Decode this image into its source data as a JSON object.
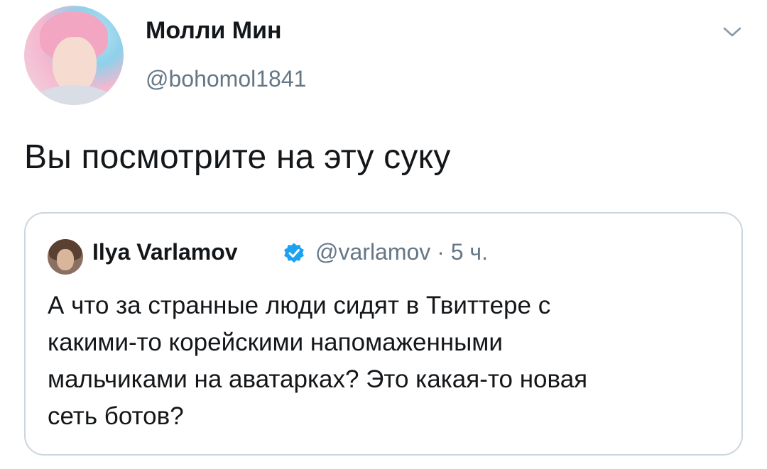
{
  "tweet": {
    "author_name": "Молли Мин",
    "author_handle": "@bohomol1841",
    "text": "Вы посмотрите на эту суку",
    "menu_icon": "chevron-down-icon"
  },
  "quoted_tweet": {
    "author_name": "Ilya Varlamov",
    "verified_icon": "verified-badge-icon",
    "author_handle": "@varlamov",
    "separator": " · ",
    "time": "5 ч.",
    "text_lines": [
      "А что за странные люди сидят в Твиттере с",
      "какими-то корейскими напомаженными",
      "мальчиками на аватарках? Это какая-то новая",
      "сеть ботов?"
    ]
  },
  "colors": {
    "text": "#14171a",
    "secondary": "#657786",
    "border": "#ccd6dd",
    "verified": "#1da1f2"
  }
}
